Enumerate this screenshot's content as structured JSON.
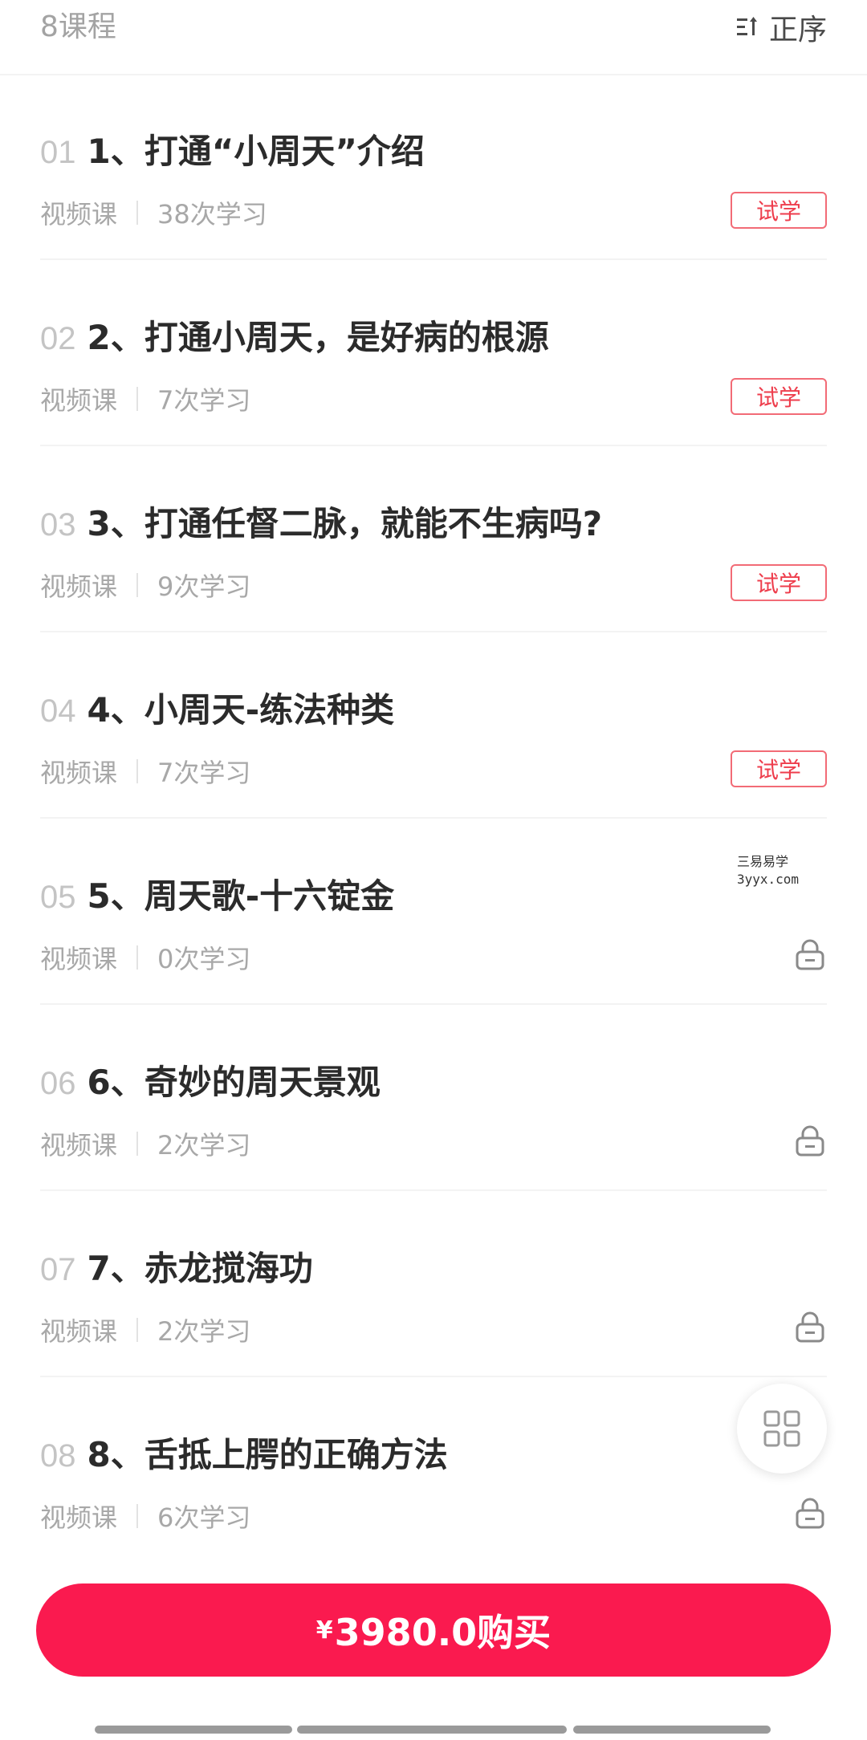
{
  "header": {
    "count_label": "8课程",
    "sort_label": "正序"
  },
  "lessons": [
    {
      "index": "01",
      "title": "1、打通“小周天”介绍",
      "type": "视频课",
      "views": "38次学习",
      "trial": "试学",
      "locked": false
    },
    {
      "index": "02",
      "title": "2、打通小周天，是好病的根源",
      "type": "视频课",
      "views": "7次学习",
      "trial": "试学",
      "locked": false
    },
    {
      "index": "03",
      "title": "3、打通任督二脉，就能不生病吗?",
      "type": "视频课",
      "views": "9次学习",
      "trial": "试学",
      "locked": false
    },
    {
      "index": "04",
      "title": "4、小周天-练法种类",
      "type": "视频课",
      "views": "7次学习",
      "trial": "试学",
      "locked": false
    },
    {
      "index": "05",
      "title": "5、周天歌-十六锭金",
      "type": "视频课",
      "views": "0次学习",
      "trial": "",
      "locked": true
    },
    {
      "index": "06",
      "title": "6、奇妙的周天景观",
      "type": "视频课",
      "views": "2次学习",
      "trial": "",
      "locked": true
    },
    {
      "index": "07",
      "title": "7、赤龙搅海功",
      "type": "视频课",
      "views": "2次学习",
      "trial": "",
      "locked": true
    },
    {
      "index": "08",
      "title": "8、舌抵上腭的正确方法",
      "type": "视频课",
      "views": "6次学习",
      "trial": "",
      "locked": true
    }
  ],
  "watermark": {
    "line1": "三易易学",
    "line2": "3yyx.com"
  },
  "buy": {
    "currency": "¥",
    "label": "3980.0购买"
  },
  "colors": {
    "accent": "#fa1a4f",
    "trial_text": "#ee3d4c",
    "muted": "#a8a8a8"
  },
  "icons": {
    "sort": "sort-order-icon",
    "lock": "lock-icon",
    "grid": "grid-menu-icon"
  }
}
